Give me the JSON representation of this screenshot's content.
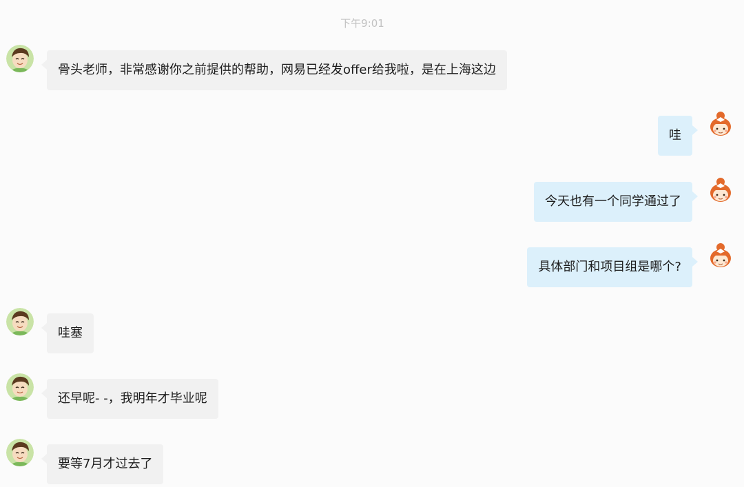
{
  "timestamp": "下午9:01",
  "messages": [
    {
      "side": "left",
      "text": "骨头老师，非常感谢你之前提供的帮助，网易已经发offer给我啦，是在上海这边"
    },
    {
      "side": "right",
      "text": "哇"
    },
    {
      "side": "right",
      "text": "今天也有一个同学通过了"
    },
    {
      "side": "right",
      "text": "具体部门和项目组是哪个?"
    },
    {
      "side": "left",
      "text": "哇塞"
    },
    {
      "side": "left",
      "text": "还早呢- -，我明年才毕业呢"
    },
    {
      "side": "left",
      "text": "要等7月才过去了"
    }
  ],
  "colors": {
    "incoming_bubble": "#f1f1f1",
    "outgoing_bubble": "#dcf0fb",
    "timestamp": "#c2c2c2"
  },
  "icons": {
    "incoming_avatar": "boy-avatar-icon",
    "outgoing_avatar": "girl-avatar-icon"
  }
}
